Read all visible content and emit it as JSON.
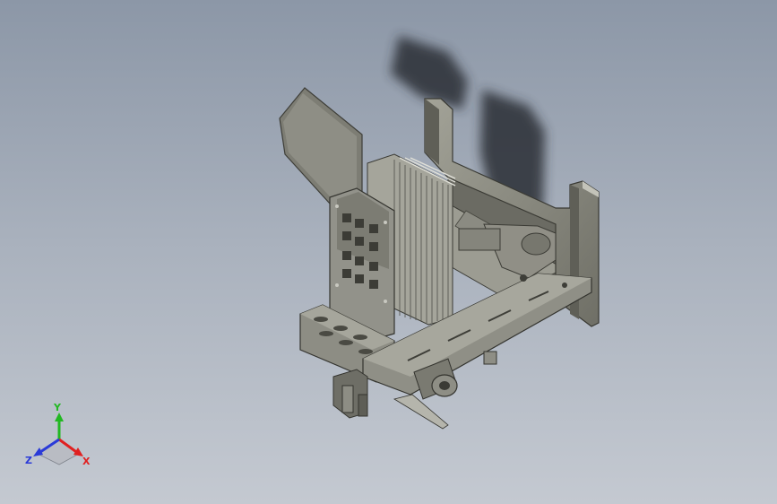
{
  "view": {
    "background_top": "#8c97a7",
    "background_bottom": "#c4c9d1",
    "part_color": "#84847a",
    "part_shade": "#55554d",
    "part_light": "#b7b7ad",
    "shadow_color": "#2c2f34"
  },
  "triad": {
    "x_label": "X",
    "y_label": "Y",
    "z_label": "Z",
    "x_color": "#e02020",
    "y_color": "#22b822",
    "z_color": "#2a3ad8"
  }
}
